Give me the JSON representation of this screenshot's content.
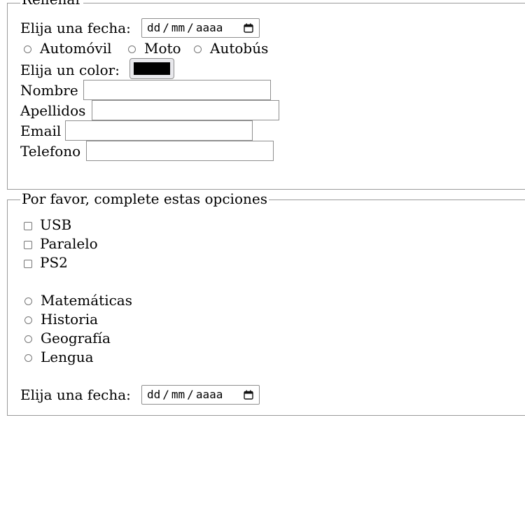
{
  "form1": {
    "legend": "Rellenar",
    "date_label": "Elija una fecha:",
    "date_placeholder": {
      "dd": "dd",
      "mm": "mm",
      "yyyy": "aaaa",
      "sep": "/"
    },
    "vehicles": [
      "Automóvil",
      "Moto",
      "Autobús"
    ],
    "color_label": "Elija un color:",
    "color_value": "#000000",
    "fields": [
      {
        "label": "Nombre",
        "value": ""
      },
      {
        "label": "Apellidos",
        "value": ""
      },
      {
        "label": "Email",
        "value": ""
      },
      {
        "label": "Telefono",
        "value": ""
      }
    ]
  },
  "form2": {
    "legend": "Por favor, complete estas opciones",
    "checkboxes": [
      "USB",
      "Paralelo",
      "PS2"
    ],
    "subjects": [
      "Matemáticas",
      "Historia",
      "Geografía",
      "Lengua"
    ],
    "date_label": "Elija una fecha:",
    "date_placeholder": {
      "dd": "dd",
      "mm": "mm",
      "yyyy": "aaaa",
      "sep": "/"
    }
  }
}
